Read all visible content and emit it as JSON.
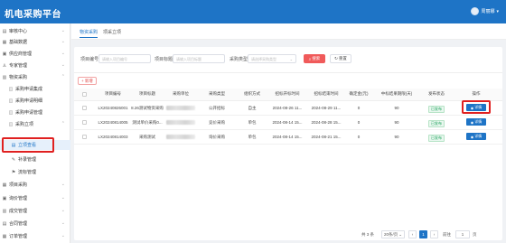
{
  "app": {
    "title": "机电采购平台",
    "user_name": "周丽娜"
  },
  "sidebar": {
    "items": [
      {
        "label": "审核中心",
        "icon": "audit-icon"
      },
      {
        "label": "基础数据",
        "icon": "database-icon"
      },
      {
        "label": "供应商管理",
        "icon": "supplier-icon"
      },
      {
        "label": "专家管理",
        "icon": "expert-icon"
      },
      {
        "label": "物资采购",
        "icon": "purchase-icon"
      },
      {
        "label": "采购申请集成"
      },
      {
        "label": "采购申请明细"
      },
      {
        "label": "采购申请管理"
      },
      {
        "label": "采购立项"
      },
      {
        "label": "立项查看"
      },
      {
        "label": "补录管理"
      },
      {
        "label": "流标管理"
      },
      {
        "label": "项目采购",
        "icon": "project-icon"
      },
      {
        "label": "询价管理",
        "icon": "inquiry-icon"
      },
      {
        "label": "成交管理",
        "icon": "deal-icon"
      },
      {
        "label": "合同管理",
        "icon": "contract-icon"
      },
      {
        "label": "订单管理",
        "icon": "order-icon"
      }
    ]
  },
  "tabs": [
    {
      "label": "物资采购"
    },
    {
      "label": "项采立项"
    }
  ],
  "filters": {
    "project_no_label": "项目编号",
    "project_no_placeholder": "请输入项目编号",
    "project_title_label": "项目标题",
    "project_title_placeholder": "请输入项目标题",
    "purchase_type_label": "采购类型",
    "purchase_type_placeholder": "请选择采购类型",
    "search_label": "搜索",
    "reset_label": "重置"
  },
  "toolbar": {
    "new_label": "新增"
  },
  "table": {
    "headers": [
      "项目编号",
      "项目标题",
      "采购单位",
      "采购类型",
      "组织方式",
      "招标开标时间",
      "招标结束时间",
      "确定金(元)",
      "中标结果期限(天)",
      "发布状态",
      "操作"
    ],
    "rows": [
      {
        "no": "LX20240826001",
        "title": "8.26测试物资采购",
        "type": "公开招标",
        "org": "自主",
        "open_time": "2024-08-26 11...",
        "end_time": "2024-08-29 11...",
        "amount": "0",
        "days": "90",
        "status": "已发布",
        "action": "详情"
      },
      {
        "no": "LX20240814005",
        "title": "测试单价采购0...",
        "type": "竞价采购",
        "org": "单包",
        "open_time": "2024-08-14 15...",
        "end_time": "2024-08-28 15...",
        "amount": "0",
        "days": "90",
        "status": "已发布",
        "action": "详情"
      },
      {
        "no": "LX20240814003",
        "title": "采购测试",
        "type": "询价采购",
        "org": "单包",
        "open_time": "2024-08-14 15...",
        "end_time": "2024-08-21 15...",
        "amount": "0",
        "days": "90",
        "status": "已发布",
        "action": "详情"
      }
    ]
  },
  "pager": {
    "total": "共 3 条",
    "page_size": "20条/页",
    "current": "1",
    "goto": "前往",
    "page_suffix": "页"
  },
  "colors": {
    "header": "#1e74c6",
    "search_button": "#f05a5a",
    "highlight": "#e02020"
  }
}
